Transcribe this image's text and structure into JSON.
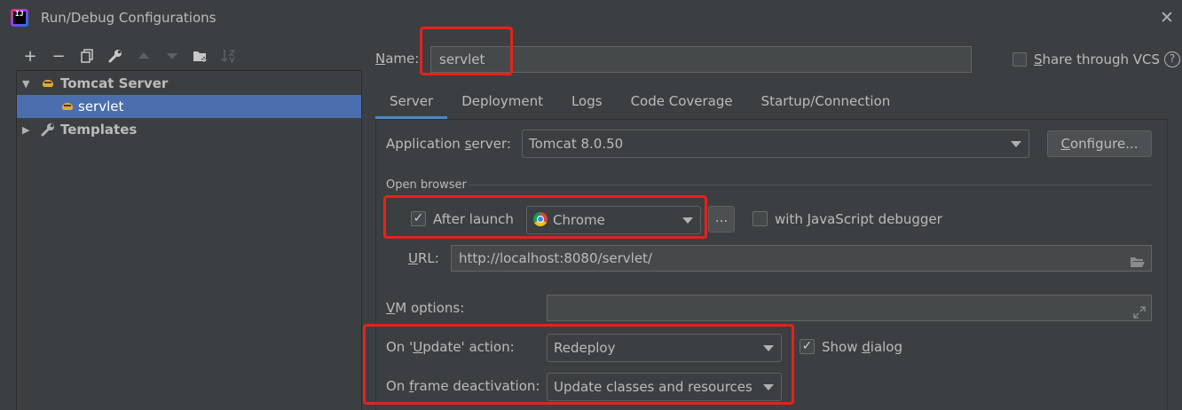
{
  "window": {
    "title": "Run/Debug Configurations",
    "close": "✕"
  },
  "toolbar": {
    "add": "+",
    "remove": "−",
    "copy": "⧉",
    "edit": "🔧",
    "up": "▲",
    "down": "▼",
    "folder": "📁",
    "sort": "↓ᵃᶻ"
  },
  "tree": {
    "tomcat_label": "Tomcat Server",
    "servlet_label": "servlet",
    "templates_label": "Templates",
    "expanded_arrow": "▼",
    "collapsed_arrow": "▶"
  },
  "name": {
    "label_prefix": "N",
    "label_rest": "ame:",
    "value": "servlet"
  },
  "vcs": {
    "label_prefix": "S",
    "label_rest": "hare through VCS",
    "checked": false,
    "help": "?"
  },
  "tabs": [
    "Server",
    "Deployment",
    "Logs",
    "Code Coverage",
    "Startup/Connection"
  ],
  "server": {
    "app_server_label_a": "Application ",
    "app_server_label_u": "s",
    "app_server_label_b": "erver:",
    "app_server_value": "Tomcat 8.0.50",
    "configure_label_u": "C",
    "configure_label_rest": "onfigure...",
    "open_browser_title": "Open browser",
    "after_launch_label": "After launch",
    "after_launch_checked": true,
    "browser_value": "Chrome",
    "browse_button": "...",
    "js_debugger_label_a": "with ",
    "js_debugger_label_u": "J",
    "js_debugger_label_b": "avaScript debugger",
    "js_debugger_checked": false,
    "url_label_u": "U",
    "url_label_rest": "RL:",
    "url_value": "http://localhost:8080/servlet/",
    "vm_label_u": "V",
    "vm_label_rest": "M options:",
    "vm_value": "",
    "update_label_a": "On '",
    "update_label_u": "U",
    "update_label_b": "pdate' action:",
    "update_value": "Redeploy",
    "show_dialog_label_a": "Show ",
    "show_dialog_label_u": "d",
    "show_dialog_label_b": "ialog",
    "show_dialog_checked": true,
    "frame_label_a": "On ",
    "frame_label_u": "f",
    "frame_label_b": "rame deactivation:",
    "frame_value": "Update classes and resources"
  },
  "colors": {
    "highlight": "#e8211a",
    "selection": "#4b6eaf",
    "tab_underline": "#4a88c7"
  }
}
